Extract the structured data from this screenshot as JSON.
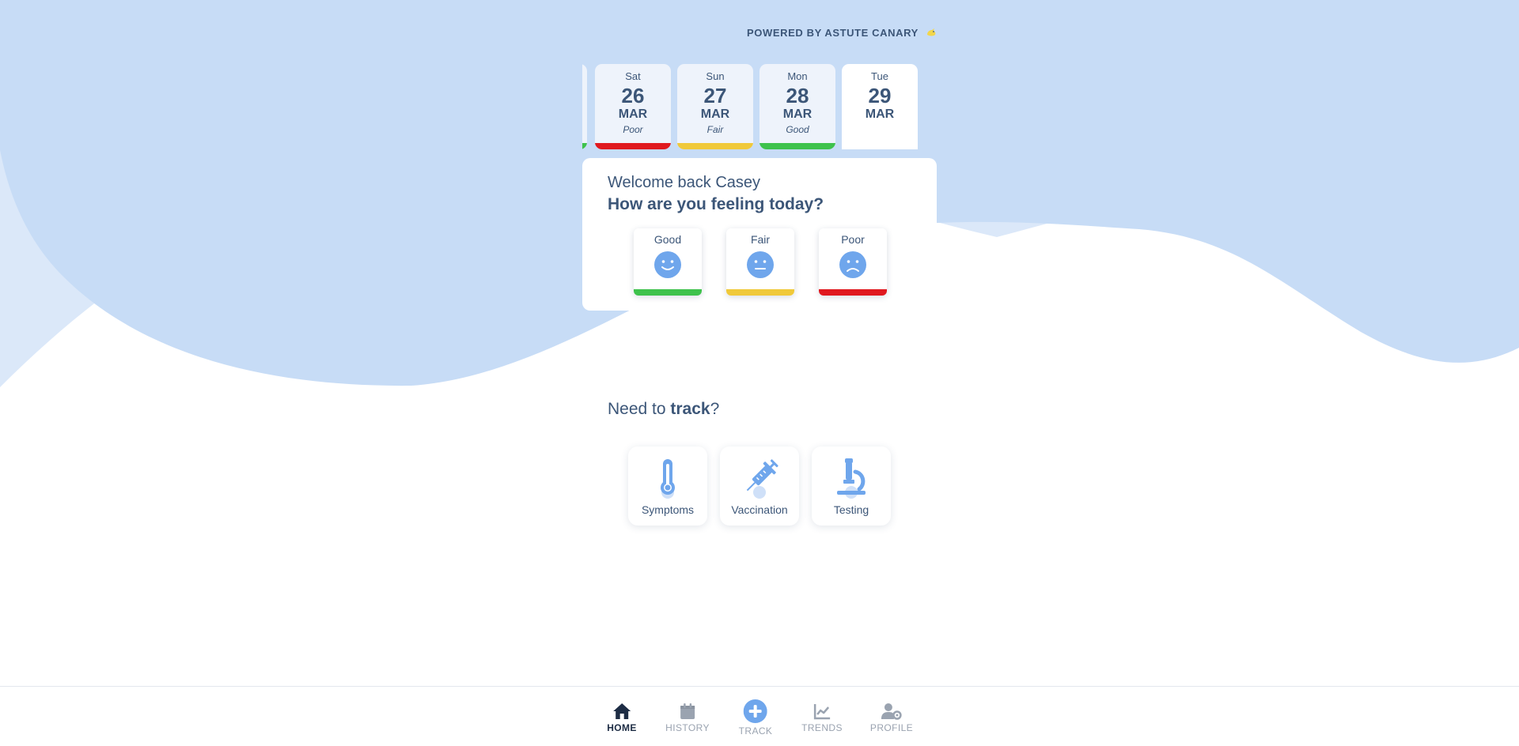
{
  "header": {
    "powered_by": "POWERED BY ASTUTE CANARY",
    "logo_icon": "canary-bird-icon"
  },
  "colors": {
    "accent": "#6fa6ec",
    "text": "#3c5678",
    "good": "#3ec24c",
    "fair": "#f0c93a",
    "poor": "#e0191f",
    "wave_light": "#c7dcf6",
    "wave_lighter": "#dbe8f9"
  },
  "day_strip": {
    "days": [
      {
        "dow": "Sat",
        "day": "26",
        "month": "MAR",
        "mood": "Poor"
      },
      {
        "dow": "Sun",
        "day": "27",
        "month": "MAR",
        "mood": "Fair"
      },
      {
        "dow": "Mon",
        "day": "28",
        "month": "MAR",
        "mood": "Good"
      },
      {
        "dow": "Tue",
        "day": "29",
        "month": "MAR",
        "mood": ""
      }
    ]
  },
  "welcome": {
    "greeting": "Welcome back Casey",
    "question": "How are you feeling today?",
    "options": [
      {
        "label": "Good",
        "icon": "smile-face-icon"
      },
      {
        "label": "Fair",
        "icon": "neutral-face-icon"
      },
      {
        "label": "Poor",
        "icon": "frown-face-icon"
      }
    ]
  },
  "track": {
    "prefix": "Need to ",
    "emphasis": "track",
    "suffix": "?",
    "buttons": [
      {
        "label": "Symptoms",
        "icon": "thermometer-icon"
      },
      {
        "label": "Vaccination",
        "icon": "syringe-icon"
      },
      {
        "label": "Testing",
        "icon": "microscope-icon"
      }
    ]
  },
  "nav": {
    "items": [
      {
        "label": "HOME",
        "icon": "home-icon",
        "active": true
      },
      {
        "label": "HISTORY",
        "icon": "calendar-icon",
        "active": false
      },
      {
        "label": "TRACK",
        "icon": "plus-circle-icon",
        "active": false
      },
      {
        "label": "TRENDS",
        "icon": "chart-line-icon",
        "active": false
      },
      {
        "label": "PROFILE",
        "icon": "user-gear-icon",
        "active": false
      }
    ]
  }
}
